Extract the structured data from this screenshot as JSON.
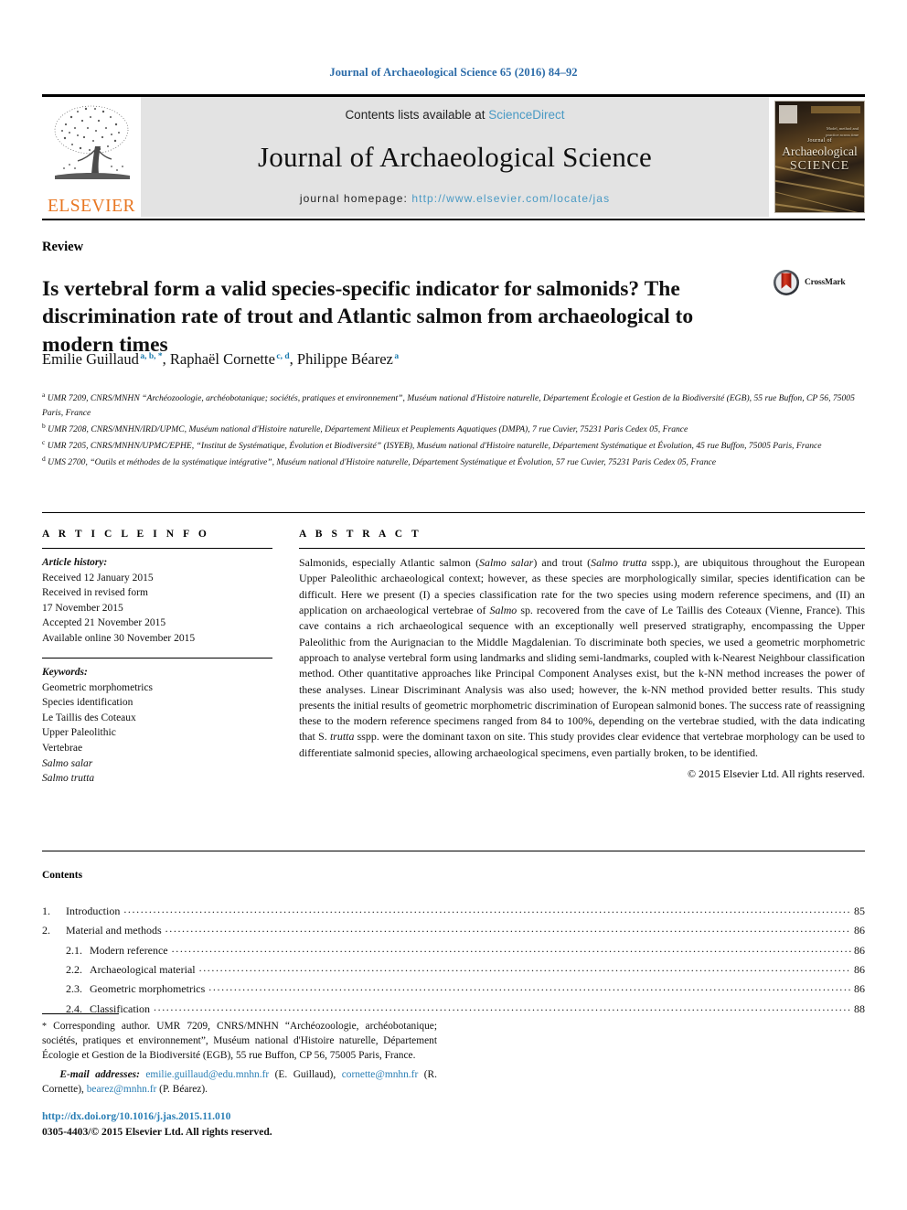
{
  "running_head": "Journal of Archaeological Science 65 (2016) 84–92",
  "masthead": {
    "publisher_logo_text": "ELSEVIER",
    "contents_prefix": "Contents lists available at ",
    "contents_link": "ScienceDirect",
    "journal_title": "Journal of Archaeological Science",
    "homepage_prefix": "journal homepage: ",
    "homepage_url": "http://www.elsevier.com/locate/jas",
    "cover": {
      "line1": "Journal of",
      "line2": "Archaeological",
      "line3": "SCIENCE",
      "corner_note": "Model, method and\npractice across time and space"
    }
  },
  "article": {
    "section_type": "Review",
    "title": "Is vertebral form a valid species-specific indicator for salmonids? The discrimination rate of trout and Atlantic salmon from archaeological to modern times",
    "crossmark_label": "CrossMark",
    "authors": [
      {
        "name": "Emilie Guillaud",
        "sup": "a, b, *"
      },
      {
        "name": "Raphaël Cornette",
        "sup": "c, d"
      },
      {
        "name": "Philippe Béarez",
        "sup": "a"
      }
    ],
    "affiliations": [
      {
        "mark": "a",
        "text": "UMR 7209, CNRS/MNHN “Archéozoologie, archéobotanique; sociétés, pratiques et environnement”, Muséum national d'Histoire naturelle, Département Écologie et Gestion de la Biodiversité (EGB), 55 rue Buffon, CP 56, 75005 Paris, France"
      },
      {
        "mark": "b",
        "text": "UMR 7208, CNRS/MNHN/IRD/UPMC, Muséum national d'Histoire naturelle, Département Milieux et Peuplements Aquatiques (DMPA), 7 rue Cuvier, 75231 Paris Cedex 05, France"
      },
      {
        "mark": "c",
        "text": "UMR 7205, CNRS/MNHN/UPMC/EPHE, “Institut de Systématique, Évolution et Biodiversité” (ISYEB), Muséum national d'Histoire naturelle, Département Systématique et Évolution, 45 rue Buffon, 75005 Paris, France"
      },
      {
        "mark": "d",
        "text": "UMS 2700, “Outils et méthodes de la systématique intégrative”, Muséum national d'Histoire naturelle, Département Systématique et Évolution, 57 rue Cuvier, 75231 Paris Cedex 05, France"
      }
    ]
  },
  "article_info": {
    "heading": "A R T I C L E   I N F O",
    "history_label": "Article history:",
    "history": [
      "Received 12 January 2015",
      "Received in revised form",
      "17 November 2015",
      "Accepted 21 November 2015",
      "Available online 30 November 2015"
    ],
    "keywords_label": "Keywords:",
    "keywords": [
      {
        "text": "Geometric morphometrics",
        "italic": false
      },
      {
        "text": "Species identification",
        "italic": false
      },
      {
        "text": "Le Taillis des Coteaux",
        "italic": false
      },
      {
        "text": "Upper Paleolithic",
        "italic": false
      },
      {
        "text": "Vertebrae",
        "italic": false
      },
      {
        "text": "Salmo salar",
        "italic": true
      },
      {
        "text": "Salmo trutta",
        "italic": true
      }
    ]
  },
  "abstract": {
    "heading": "A B S T R A C T",
    "paragraphs": [
      "Salmonids, especially Atlantic salmon (Salmo salar) and trout (Salmo trutta sspp.), are ubiquitous throughout the European Upper Paleolithic archaeological context; however, as these species are morphologically similar, species identification can be difficult. Here we present (I) a species classification rate for the two species using modern reference specimens, and (II) an application on archaeological vertebrae of Salmo sp. recovered from the cave of Le Taillis des Coteaux (Vienne, France). This cave contains a rich archaeological sequence with an exceptionally well preserved stratigraphy, encompassing the Upper Paleolithic from the Aurignacian to the Middle Magdalenian. To discriminate both species, we used a geometric morphometric approach to analyse vertebral form using landmarks and sliding semi-landmarks, coupled with k-Nearest Neighbour classification method. Other quantitative approaches like Principal Component Analyses exist, but the k-NN method increases the power of these analyses. Linear Discriminant Analysis was also used; however, the k-NN method provided better results. This study presents the initial results of geometric morphometric discrimination of European salmonid bones. The success rate of reassigning these to the modern reference specimens ranged from 84 to 100%, depending on the vertebrae studied, with the data indicating that S. trutta sspp. were the dominant taxon on site. This study provides clear evidence that vertebrae morphology can be used to differentiate salmonid species, allowing archaeological specimens, even partially broken, to be identified."
    ],
    "copyright": "© 2015 Elsevier Ltd. All rights reserved."
  },
  "contents": {
    "heading": "Contents",
    "entries": [
      {
        "num": "1.",
        "label": "Introduction",
        "page": "85",
        "sub": false
      },
      {
        "num": "2.",
        "label": "Material and methods",
        "page": "86",
        "sub": false
      },
      {
        "num": "2.1.",
        "label": "Modern reference",
        "page": "86",
        "sub": true
      },
      {
        "num": "2.2.",
        "label": "Archaeological material",
        "page": "86",
        "sub": true
      },
      {
        "num": "2.3.",
        "label": "Geometric morphometrics",
        "page": "86",
        "sub": true
      },
      {
        "num": "2.4.",
        "label": "Classification",
        "page": "88",
        "sub": true
      }
    ]
  },
  "footer": {
    "corresponding_marker": "*",
    "corresponding_text": "Corresponding author. UMR 7209, CNRS/MNHN “Archéozoologie, archéobotanique; sociétés, pratiques et environnement”, Muséum national d'Histoire naturelle, Département Écologie et Gestion de la Biodiversité (EGB), 55 rue Buffon, CP 56, 75005 Paris, France.",
    "email_label": "E-mail addresses:",
    "emails": [
      {
        "address": "emilie.guillaud@edu.mnhn.fr",
        "person": "(E. Guillaud)"
      },
      {
        "address": "cornette@mnhn.fr",
        "person": "(R. Cornette)"
      },
      {
        "address": "bearez@mnhn.fr",
        "person": "(P. Béarez)"
      }
    ],
    "doi_url": "http://dx.doi.org/10.1016/j.jas.2015.11.010",
    "issn_line": "0305-4403/© 2015 Elsevier Ltd. All rights reserved."
  },
  "colors": {
    "link_blue": "#2b7fb5",
    "sciencedirect_blue": "#4a9ac4",
    "elsevier_orange": "#E87722",
    "running_head_blue": "#2b6ba8",
    "masthead_gray": "#e3e3e3"
  }
}
